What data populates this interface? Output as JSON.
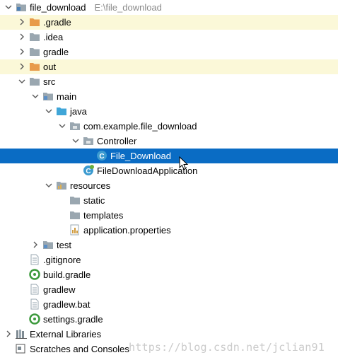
{
  "project": {
    "root_label": "file_download",
    "root_path": "E:\\file_download"
  },
  "tree": [
    {
      "label": "file_download",
      "path": "E:\\file_download",
      "icon": "project-folder-icon",
      "chevron": "down",
      "indent": 0,
      "row": 0
    },
    {
      "label": ".gradle",
      "icon": "folder-orange-icon",
      "chevron": "right",
      "indent": 1,
      "row": 1,
      "highlight": "excluded"
    },
    {
      "label": ".idea",
      "icon": "folder-gray-icon",
      "chevron": "right",
      "indent": 1,
      "row": 2
    },
    {
      "label": "gradle",
      "icon": "folder-gray-icon",
      "chevron": "right",
      "indent": 1,
      "row": 3
    },
    {
      "label": "out",
      "icon": "folder-orange-icon",
      "chevron": "right",
      "indent": 1,
      "row": 4,
      "highlight": "excluded"
    },
    {
      "label": "src",
      "icon": "folder-gray-icon",
      "chevron": "down",
      "indent": 1,
      "row": 5
    },
    {
      "label": "main",
      "icon": "folder-module-icon",
      "chevron": "down",
      "indent": 2,
      "row": 6
    },
    {
      "label": "java",
      "icon": "folder-source-icon",
      "chevron": "down",
      "indent": 3,
      "row": 7
    },
    {
      "label": "com.example.file_download",
      "icon": "package-icon",
      "chevron": "down",
      "indent": 4,
      "row": 8
    },
    {
      "label": "Controller",
      "icon": "package-icon",
      "chevron": "down",
      "indent": 5,
      "row": 9
    },
    {
      "label": "File_Download",
      "icon": "class-icon",
      "chevron": "none",
      "indent": 6,
      "row": 10,
      "selected": true
    },
    {
      "label": "FileDownloadApplication",
      "icon": "spring-class-icon",
      "chevron": "none",
      "indent": 5,
      "row": 11
    },
    {
      "label": "resources",
      "icon": "folder-resources-icon",
      "chevron": "down",
      "indent": 3,
      "row": 12
    },
    {
      "label": "static",
      "icon": "folder-gray-icon",
      "chevron": "none",
      "indent": 4,
      "row": 13
    },
    {
      "label": "templates",
      "icon": "folder-gray-icon",
      "chevron": "none",
      "indent": 4,
      "row": 14
    },
    {
      "label": "application.properties",
      "icon": "properties-file-icon",
      "chevron": "none",
      "indent": 4,
      "row": 15
    },
    {
      "label": "test",
      "icon": "folder-module-icon",
      "chevron": "right",
      "indent": 2,
      "row": 16
    },
    {
      "label": ".gitignore",
      "icon": "text-file-icon",
      "chevron": "none",
      "indent": 1,
      "row": 17
    },
    {
      "label": "build.gradle",
      "icon": "gradle-file-icon",
      "chevron": "none",
      "indent": 1,
      "row": 18
    },
    {
      "label": "gradlew",
      "icon": "text-file-icon",
      "chevron": "none",
      "indent": 1,
      "row": 19
    },
    {
      "label": "gradlew.bat",
      "icon": "text-file-icon",
      "chevron": "none",
      "indent": 1,
      "row": 20
    },
    {
      "label": "settings.gradle",
      "icon": "gradle-file-icon",
      "chevron": "none",
      "indent": 1,
      "row": 21
    },
    {
      "label": "External Libraries",
      "icon": "libraries-icon",
      "chevron": "right",
      "indent": 0,
      "row": 22
    },
    {
      "label": "Scratches and Consoles",
      "icon": "scratches-icon",
      "chevron": "none",
      "indent": 0,
      "row": 23
    }
  ],
  "watermark": "https://blog.csdn.net/jclian91",
  "colors": {
    "selection": "#0a6cc4",
    "excluded_highlight": "#fbf8d8",
    "folder_gray": "#9aa7b0",
    "folder_orange": "#e89b4a",
    "folder_blue": "#40a6d8",
    "class_blue": "#3c9bd0",
    "gradle_green": "#3d9a3d"
  }
}
